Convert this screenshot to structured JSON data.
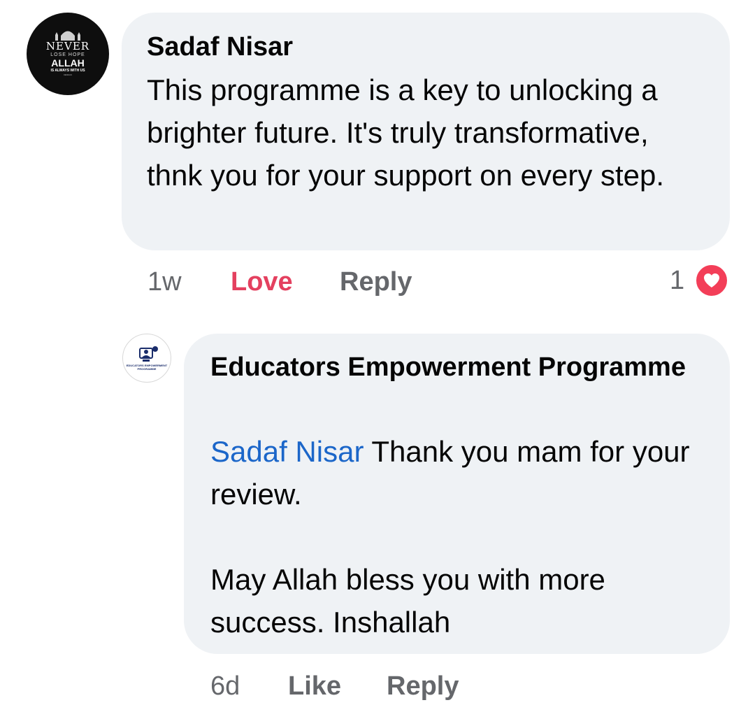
{
  "comment": {
    "avatar": {
      "line1": "NEVER",
      "line2": "LOSE HOPE",
      "line3": "ALLAH",
      "line4": "IS ALWAYS WITH US",
      "line5": "DESIGN"
    },
    "author": "Sadaf Nisar",
    "text": "This programme is a key to unlocking a brighter future. It's truly transformative, thnk you for your support on every step.",
    "time": "1w",
    "reaction_label": "Love",
    "reply_label": "Reply",
    "reaction_count": "1",
    "reaction_icon": "heart-icon",
    "reaction_color": "#f33e58"
  },
  "reply": {
    "avatar": {
      "logo_text": "EDUCATORS EMPOWERMENT PROGRAMME"
    },
    "author": "Educators Empowerment Programme",
    "mention": "Sadaf Nisar",
    "text": " Thank you mam for your review.\n\nMay Allah bless you with more success. Inshallah",
    "time": "6d",
    "like_label": "Like",
    "reply_label": "Reply",
    "mention_color": "#1b66c9"
  }
}
